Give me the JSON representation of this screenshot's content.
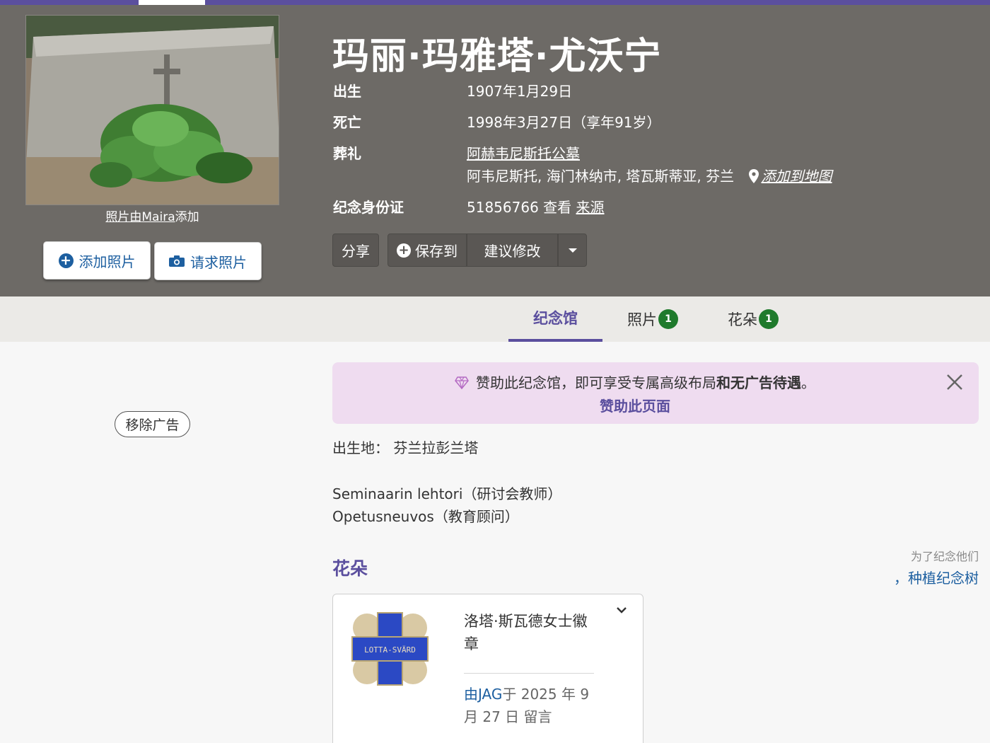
{
  "hero": {
    "name": "玛丽·玛雅塔·尤沃宁",
    "photo_credit_prefix": "照片由",
    "photo_credit_user": "Maira",
    "photo_credit_suffix": "添加",
    "add_photo_label": "添加照片",
    "request_photo_label": "请求照片"
  },
  "details": {
    "birth_label": "出生",
    "birth_value": "1907年1月29日",
    "death_label": "死亡",
    "death_value": "1998年3月27日（享年91岁）",
    "burial_label": "葬礼",
    "cemetery": "阿赫韦尼斯托公墓",
    "location": "阿韦尼斯托, 海门林纳市, 塔瓦斯蒂亚, 芬兰",
    "add_to_map": "添加到地图",
    "memorial_id_label": "纪念身份证",
    "memorial_id_value": "51856766 查看",
    "source_link": "来源"
  },
  "actions": {
    "share": "分享",
    "save_to": "保存到",
    "suggest_edit": "建议修改"
  },
  "tabs": [
    {
      "label": "纪念馆",
      "badge": ""
    },
    {
      "label": "照片",
      "badge": "1"
    },
    {
      "label": "花朵",
      "badge": "1"
    }
  ],
  "ads": {
    "remove_ads": "移除广告"
  },
  "sponsor": {
    "text_normal": "赞助此纪念馆，即可享受专属高级布局",
    "text_bold": "和无广告待遇",
    "text_end": "。",
    "link": "赞助此页面"
  },
  "bio": {
    "birthplace": "出生地：  芬兰拉彭兰塔",
    "line1": "Seminaarin lehtori（研讨会教师）",
    "line2": "Opetusneuvos（教育顾问）"
  },
  "flowers": {
    "section_title": "花朵",
    "side_note": "为了纪念他们",
    "side_link": "，种植纪念树",
    "card_title": "洛塔·斯瓦德女士徽章",
    "card_by": "由JAG",
    "card_meta": "于 2025 年 9 月 27 日 留言",
    "badge_text": "LOTTA-SVÄRD"
  },
  "colors": {
    "brand_purple": "#5b4f9e",
    "hero_gray": "#6d6a66",
    "link_blue": "#1d5fa0",
    "badge_green": "#1f7a2c",
    "sponsor_bg": "#efdcf0"
  }
}
